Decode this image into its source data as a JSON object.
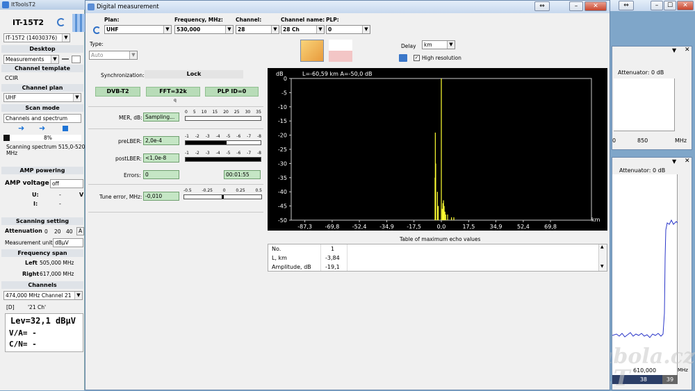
{
  "left": {
    "title": "ItToolsT2",
    "device_name": "IT-15T2",
    "device_select": "IT-15T2 (14030376)",
    "desktop_label": "Desktop",
    "desktop_value": "Measurements",
    "channel_template_label": "Channel template",
    "channel_template_value": "CCIR",
    "channel_plan_label": "Channel plan",
    "channel_plan_value": "UHF",
    "scan_mode_label": "Scan mode",
    "scan_mode_value": "Channels and spectrum",
    "progress_text": "8%",
    "progress_fraction": 0.08,
    "scanning_line1": "Scanning spectrum 515,0-520,0",
    "scanning_line2": "MHz",
    "amp_powering_label": "AMP powering",
    "amp_voltage_label": "AMP voltage",
    "amp_voltage_value": "off",
    "u_label": "U:",
    "u_value": "-",
    "v_unit": "V",
    "i_label": "I:",
    "i_value": "-",
    "scanning_setting_label": "Scanning setting",
    "attenuation_label": "Attenuation",
    "att_values": [
      "0",
      "20",
      "40",
      "A"
    ],
    "meas_units_label": "Measurement units",
    "meas_units_value": "dBµV",
    "freq_span_label": "Frequency span",
    "left_label": "Left",
    "left_value": "505,000 MHz",
    "right_label": "Right",
    "right_value": "617,000 MHz",
    "channels_label": "Channels",
    "channel_select": "474,000 MHz  Channel 21",
    "ch_tag": "[D]",
    "ch_name": "'21 Ch'",
    "lev": "Lev=32,1 dBµV",
    "va": "V/A= -",
    "cn": "C/N= -"
  },
  "dialog": {
    "title": "Digital measurement",
    "plan_label": "Plan:",
    "plan_value": "UHF",
    "freq_label": "Frequency, MHz:",
    "freq_value": "530,000",
    "channel_label": "Channel:",
    "channel_value": "28",
    "chname_label": "Channel name:",
    "chname_value": "28 Ch",
    "plp_label": "PLP:",
    "plp_value": "0",
    "type_label": "Type:",
    "type_value": "Auto",
    "delay_label": "Delay",
    "delay_unit": "km",
    "high_res_label": "High resolution",
    "sync_label": "Synchronization:",
    "sync_value": "Lock",
    "dvb": "DVB-T2",
    "fft": "FFT=32k",
    "plp_id": "PLP ID=0",
    "q_label": "q",
    "mer_label": "MER, dB:",
    "mer_value": "Sampling...",
    "mer_ticks": [
      "0",
      "5",
      "10",
      "15",
      "20",
      "25",
      "30",
      "35"
    ],
    "preber_label": "preLBER:",
    "preber_value": "2,0e-4",
    "postber_label": "postLBER:",
    "postber_value": "<1,0e-8",
    "ber_ticks": [
      "-1",
      "-2",
      "-3",
      "-4",
      "-5",
      "-6",
      "-7",
      "-8"
    ],
    "preber_fill": 0.55,
    "postber_fill": 1.0,
    "errors_label": "Errors:",
    "errors_value": "0",
    "timer_value": "00:01:55",
    "tune_label": "Tune error, MHz:",
    "tune_value": "-0,010",
    "tune_ticks": [
      "-0.5",
      "-0.25",
      "0",
      "0.25",
      "0.5"
    ],
    "echo_title": "Table of maximum echo values",
    "echo_rows": [
      {
        "k": "No.",
        "v": "1"
      },
      {
        "k": "L, km",
        "v": "-3,84"
      },
      {
        "k": "Amplitude, dB",
        "v": "-19,1"
      }
    ]
  },
  "chart_data": {
    "type": "line",
    "title": "L=-60,59 km    A=-50,0 dB",
    "ylabel": "dB",
    "xlabel": "km",
    "ylim": [
      -50,
      0
    ],
    "xlim": [
      -96,
      96
    ],
    "yticks": [
      "0",
      "-5",
      "-10",
      "-15",
      "-20",
      "-25",
      "-30",
      "-35",
      "-40",
      "-45",
      "-50"
    ],
    "xticks": [
      "-87,3",
      "-69,8",
      "-52,4",
      "-34,9",
      "-17,5",
      "0,0",
      "17,5",
      "34,9",
      "52,4",
      "69,8"
    ],
    "xtick_values": [
      -87.3,
      -69.8,
      -52.4,
      -34.9,
      -17.5,
      0.0,
      17.5,
      34.9,
      52.4,
      69.8
    ],
    "series": [
      {
        "color": "#ffff33",
        "x": [
          -4.0,
          -3.84,
          -3.6,
          -2.5,
          -2.0,
          0.0,
          0.6,
          1.0,
          1.4,
          1.8,
          2.3,
          2.8,
          4.0,
          6.5,
          8.0
        ],
        "y": [
          -35,
          -19.1,
          -30,
          -40,
          -45,
          0,
          -46,
          -44,
          -43,
          -45,
          -47,
          -48,
          -48,
          -49,
          -49
        ]
      }
    ],
    "grid": false
  },
  "right": {
    "top_att": "Attenuator: 0 dB",
    "top_xtick1": "0",
    "top_xtick2": "850",
    "top_unit": "MHz",
    "bottom_att": "Attenuator: 0 dB",
    "bottom_freq": "610,000",
    "bottom_unit": "MHz",
    "ch_a": "38",
    "ch_b": "39",
    "watermark1": "Parabola.cz",
    "watermark2": "ALT"
  }
}
